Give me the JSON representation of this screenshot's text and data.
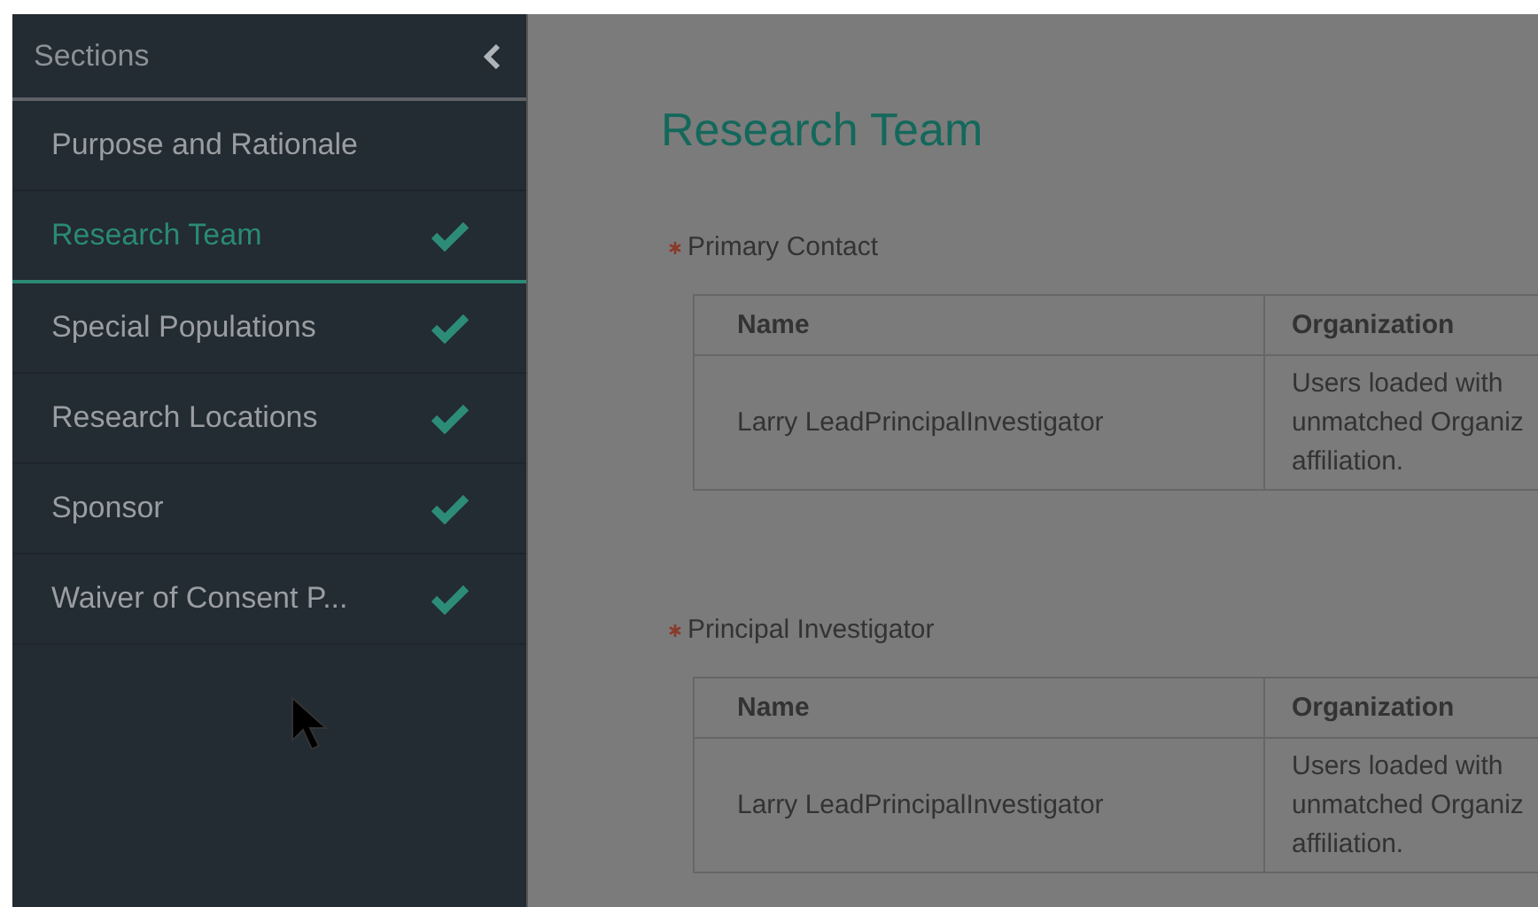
{
  "sidebar": {
    "title": "Sections",
    "items": [
      {
        "label": "Purpose and Rationale",
        "selected": false,
        "complete": false
      },
      {
        "label": "Research Team",
        "selected": true,
        "complete": true
      },
      {
        "label": "Special Populations",
        "selected": false,
        "complete": true
      },
      {
        "label": "Research Locations",
        "selected": false,
        "complete": true
      },
      {
        "label": "Sponsor",
        "selected": false,
        "complete": true
      },
      {
        "label": "Waiver of Consent P...",
        "selected": false,
        "complete": true
      }
    ]
  },
  "main": {
    "title": "Research Team",
    "sections": [
      {
        "label": "Primary Contact",
        "required": true,
        "columns": [
          "Name",
          "Organization"
        ],
        "rows": [
          {
            "name": "Larry LeadPrincipalInvestigator",
            "organization": [
              "Users loaded with",
              "unmatched Organiz",
              "affiliation."
            ]
          }
        ]
      },
      {
        "label": "Principal Investigator",
        "required": true,
        "columns": [
          "Name",
          "Organization"
        ],
        "rows": [
          {
            "name": "Larry LeadPrincipalInvestigator",
            "organization": [
              "Users loaded with",
              "unmatched Organiz",
              "affiliation."
            ]
          }
        ]
      }
    ]
  }
}
